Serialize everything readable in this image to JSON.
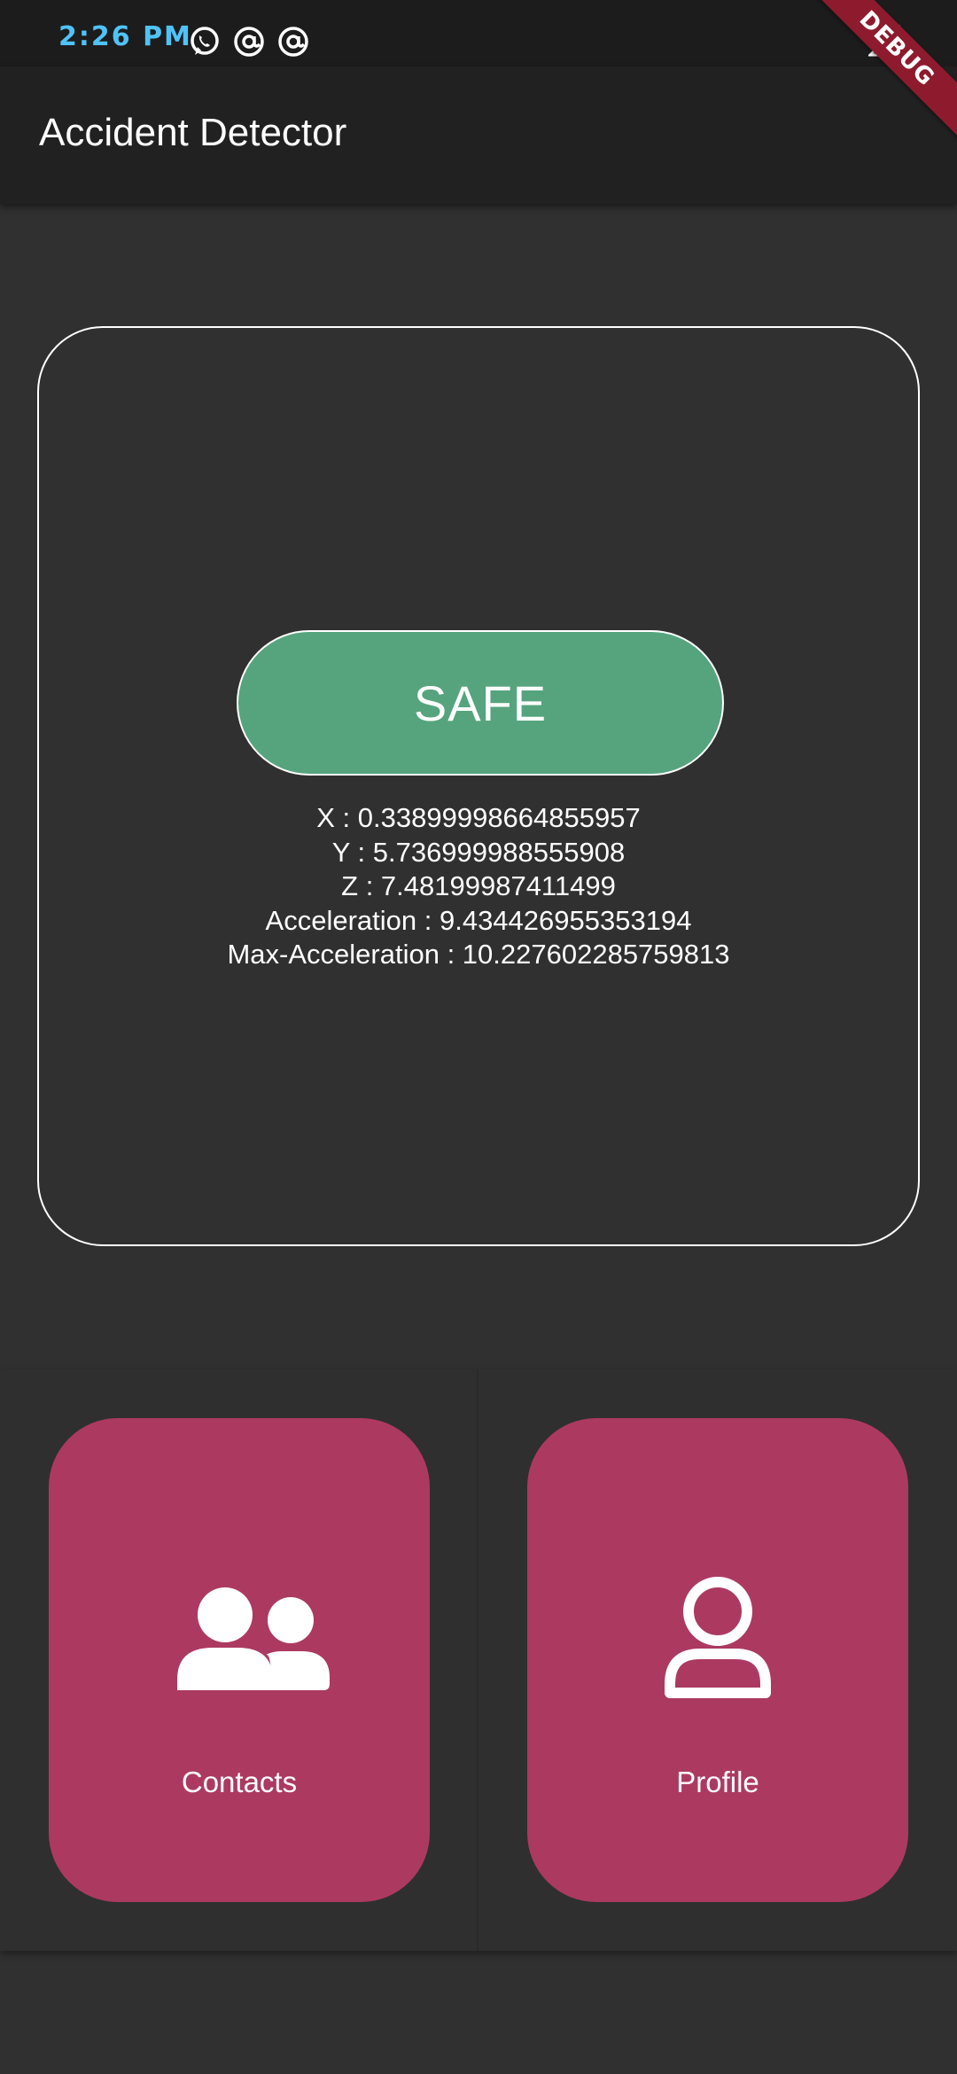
{
  "status_bar": {
    "time": "2:26 PM",
    "battery": "53",
    "icons": [
      "whatsapp-icon",
      "at-sign-icon",
      "at-sign-icon",
      "signal-icon"
    ]
  },
  "app_bar": {
    "title": "Accident Detector"
  },
  "debug_banner": "DEBUG",
  "monitor": {
    "status_label": "SAFE",
    "status_color": "#56a47e",
    "readings": [
      "X : 0.33899998664855957",
      "Y : 5.736999988555908",
      "Z : 7.48199987411499",
      "Acceleration : 9.434426955353194",
      "Max-Acceleration : 10.227602285759813"
    ]
  },
  "tiles": {
    "color": "#ac3a60",
    "contacts": {
      "label": "Contacts",
      "icon": "users-icon"
    },
    "profile": {
      "label": "Profile",
      "icon": "user-icon"
    }
  }
}
